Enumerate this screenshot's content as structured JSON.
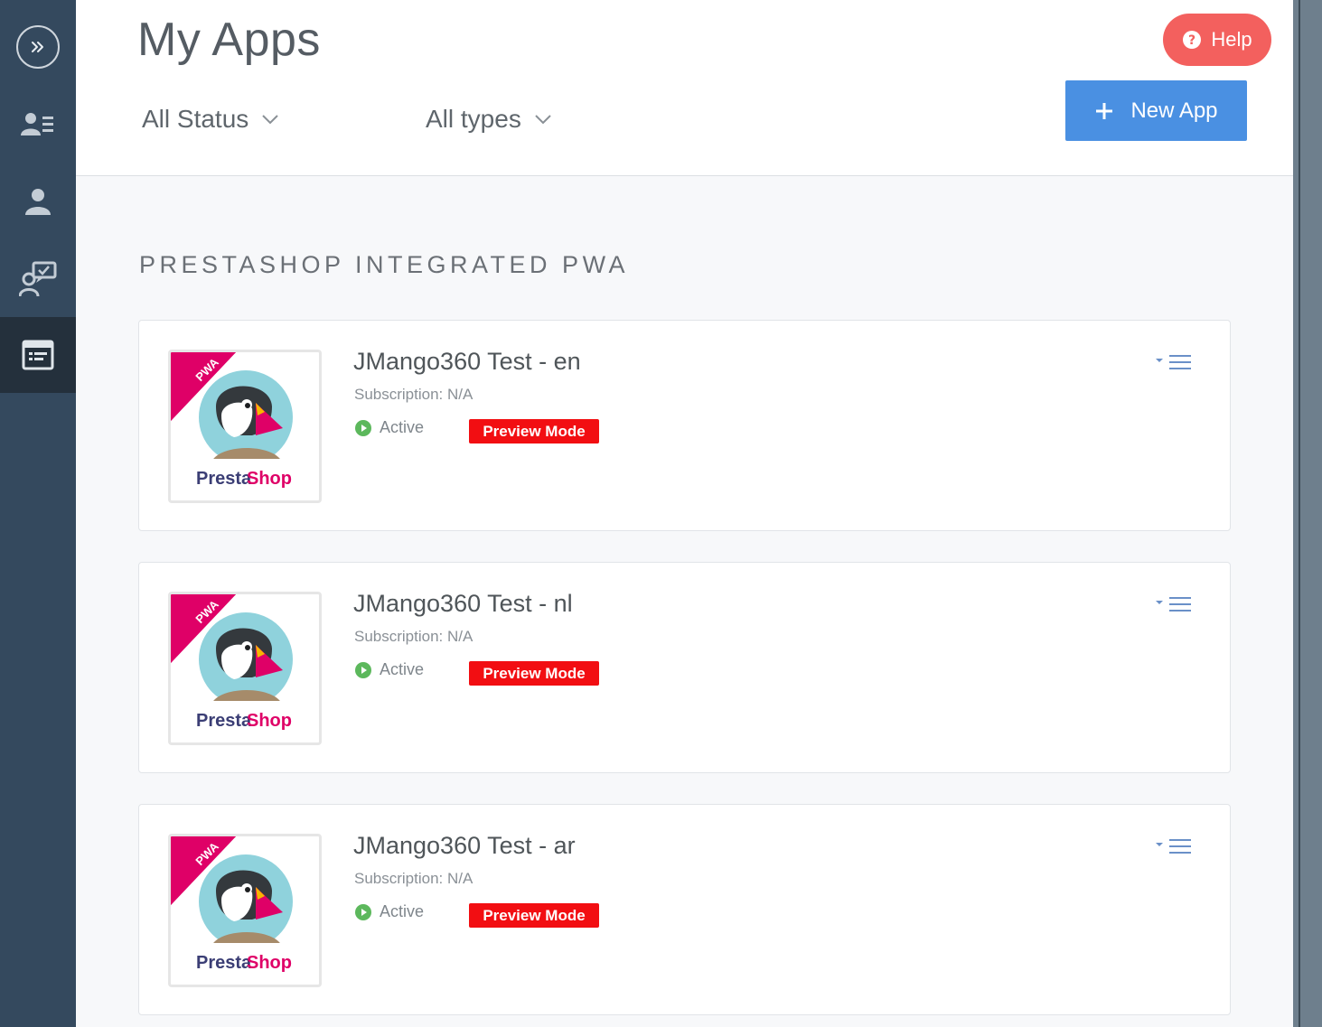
{
  "page": {
    "title": "My Apps"
  },
  "sidebar": {
    "items": [
      {
        "icon": "expand-chevrons-icon"
      },
      {
        "icon": "contacts-list-icon"
      },
      {
        "icon": "user-icon"
      },
      {
        "icon": "user-feedback-icon"
      },
      {
        "icon": "apps-window-icon",
        "active": true
      }
    ]
  },
  "filters": {
    "status": "All Status",
    "types": "All types"
  },
  "header_actions": {
    "help_label": "Help",
    "new_app_label": "New App"
  },
  "section": {
    "title": "PRESTASHOP INTEGRATED PWA"
  },
  "apps": [
    {
      "name": "JMango360 Test - en",
      "subscription": "Subscription: N/A",
      "status": "Active",
      "badge": "Preview Mode",
      "ribbon": "PWA",
      "logo_text_1": "Presta",
      "logo_text_2": "Shop"
    },
    {
      "name": "JMango360 Test - nl",
      "subscription": "Subscription: N/A",
      "status": "Active",
      "badge": "Preview Mode",
      "ribbon": "PWA",
      "logo_text_1": "Presta",
      "logo_text_2": "Shop"
    },
    {
      "name": "JMango360 Test - ar",
      "subscription": "Subscription: N/A",
      "status": "Active",
      "badge": "Preview Mode",
      "ribbon": "PWA",
      "logo_text_1": "Presta",
      "logo_text_2": "Shop"
    }
  ],
  "colors": {
    "sidebar": "#34495e",
    "help": "#f3605e",
    "primary": "#4a90e2",
    "badge": "#f20e12",
    "active_status": "#5cb85c",
    "brand_pink": "#df0067"
  }
}
